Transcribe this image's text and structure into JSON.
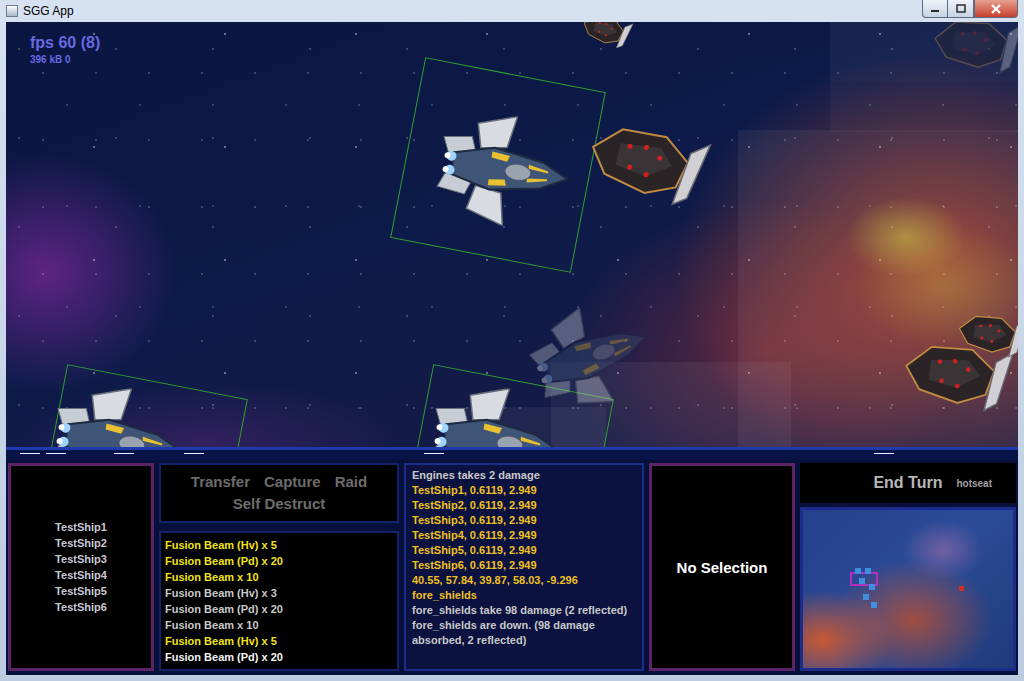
{
  "window": {
    "title": "SGG App"
  },
  "hud": {
    "fps": "fps 60 (8)",
    "memory": "396 kB 0"
  },
  "ships": [
    {
      "kind": "player",
      "selected": true,
      "faded": false
    },
    {
      "kind": "player",
      "selected": true,
      "faded": false
    },
    {
      "kind": "player",
      "selected": true,
      "faded": false
    },
    {
      "kind": "player",
      "selected": false,
      "faded": true
    },
    {
      "kind": "enemy",
      "selected": false,
      "faded": false
    },
    {
      "kind": "enemy",
      "selected": false,
      "faded": false
    },
    {
      "kind": "enemy",
      "selected": false,
      "faded": false
    },
    {
      "kind": "enemy",
      "selected": false,
      "faded": false
    },
    {
      "kind": "enemy",
      "selected": false,
      "faded": true
    }
  ],
  "fleet": {
    "items": [
      "TestShip1",
      "TestShip2",
      "TestShip3",
      "TestShip4",
      "TestShip5",
      "TestShip6"
    ]
  },
  "actions": [
    {
      "label": "Transfer",
      "disabled": true
    },
    {
      "label": "Capture",
      "disabled": true
    },
    {
      "label": "Raid",
      "disabled": true
    },
    {
      "label": "Self Destruct",
      "disabled": true
    }
  ],
  "weapons": [
    {
      "label": "Fusion Beam (Hv) x 5",
      "color": "#f2e21a"
    },
    {
      "label": "Fusion Beam (Pd) x 20",
      "color": "#f2e21a"
    },
    {
      "label": "Fusion Beam x 10",
      "color": "#f2e21a"
    },
    {
      "label": "Fusion Beam (Hv) x 3",
      "color": "#c8c8c8"
    },
    {
      "label": "Fusion Beam (Pd) x 20",
      "color": "#c8c8c8"
    },
    {
      "label": "Fusion Beam x 10",
      "color": "#c8c8c8"
    },
    {
      "label": "Fusion Beam (Hv) x 5",
      "color": "#f2e21a"
    },
    {
      "label": "Fusion Beam (Pd) x 20",
      "color": "#f4f4f4"
    }
  ],
  "log": [
    {
      "text": "Engines takes 2 damage",
      "color": "#c8c8c8"
    },
    {
      "text": "TestShip1, 0.6119, 2.949",
      "color": "#f0c020"
    },
    {
      "text": "TestShip2, 0.6119, 2.949",
      "color": "#f0c020"
    },
    {
      "text": "TestShip3, 0.6119, 2.949",
      "color": "#f0c020"
    },
    {
      "text": "TestShip4, 0.6119, 2.949",
      "color": "#f0c020"
    },
    {
      "text": "TestShip5, 0.6119, 2.949",
      "color": "#f0c020"
    },
    {
      "text": "TestShip6, 0.6119, 2.949",
      "color": "#f0c020"
    },
    {
      "text": "40.55, 57.84, 39.87, 58.03, -9.296",
      "color": "#f0c020"
    },
    {
      "text": "fore_shields",
      "color": "#f0c020"
    },
    {
      "text": "fore_shields take 98 damage (2 reflected)",
      "color": "#c8c8c8"
    },
    {
      "text": "fore_shields are down. (98 damage absorbed, 2 reflected)",
      "color": "#c8c8c8"
    }
  ],
  "selection": {
    "label": "No Selection"
  },
  "turn": {
    "button": "End Turn",
    "mode": "hotseat"
  },
  "minimap": {
    "markers": [
      {
        "kind": "player",
        "color": "#3f8fe0"
      },
      {
        "kind": "player",
        "color": "#3f8fe0"
      },
      {
        "kind": "player",
        "color": "#3f8fe0"
      },
      {
        "kind": "player",
        "color": "#3f8fe0"
      },
      {
        "kind": "player",
        "color": "#3f8fe0"
      },
      {
        "kind": "player",
        "color": "#3f8fe0"
      },
      {
        "kind": "enemy",
        "color": "#d03020"
      }
    ]
  }
}
